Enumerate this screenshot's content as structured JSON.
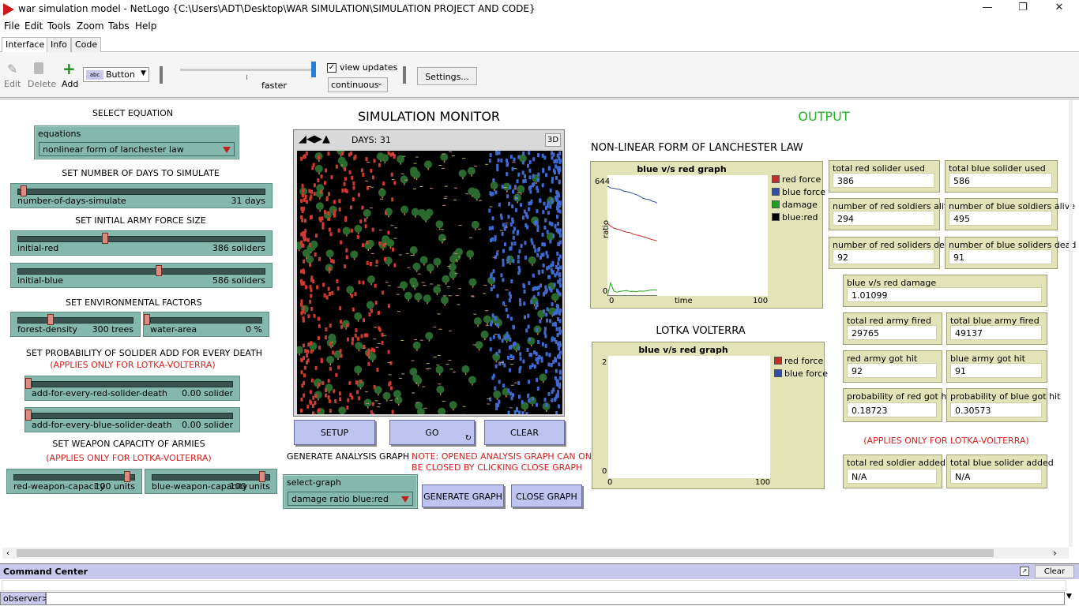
{
  "window": {
    "title": "war simulation model - NetLogo {C:\\Users\\ADT\\Desktop\\WAR SIMULATION\\SIMULATION PROJECT AND CODE}"
  },
  "menu": [
    "File",
    "Edit",
    "Tools",
    "Zoom",
    "Tabs",
    "Help"
  ],
  "tabs": [
    "Interface",
    "Info",
    "Code"
  ],
  "toolbar": {
    "edit": "Edit",
    "delete": "Delete",
    "add": "Add",
    "widget_type": "Button",
    "speed_label": "faster",
    "view_updates": "view updates",
    "update_mode": "continuous",
    "settings": "Settings..."
  },
  "left": {
    "select_equation": "SELECT EQUATION",
    "equations_label": "equations",
    "equations_value": "nonlinear form of lanchester law",
    "set_days": "SET NUMBER OF DAYS TO SIMULATE",
    "days_name": "number-of-days-simulate",
    "days_value": "31 days",
    "set_initial": "SET INITIAL ARMY FORCE SIZE",
    "red_name": "initial-red",
    "red_value": "386 soliders",
    "blue_name": "initial-blue",
    "blue_value": "586 soliders",
    "set_env": "SET ENVIRONMENTAL FACTORS",
    "forest_name": "forest-density",
    "forest_value": "300 trees",
    "water_name": "water-area",
    "water_value": "0 %",
    "set_prob": "SET PROBABILITY OF SOLIDER ADD FOR EVERY DEATH",
    "applies_lv": "(APPLIES ONLY FOR LOTKA-VOLTERRA)",
    "add_red_name": "add-for-every-red-solider-death",
    "add_red_value": "0.00 solider",
    "add_blue_name": "add-for-every-blue-solider-death",
    "add_blue_value": "0.00 solider",
    "set_weapon": "SET WEAPON CAPACITY OF ARMIES",
    "applies_lv2": "(APPLIES ONLY FOR LOTKA-VOLTERRA)",
    "rw_name": "red-weapon-capacity",
    "rw_value": "100 units",
    "bw_name": "blue-weapon-capacity",
    "bw_value": "100 units"
  },
  "center": {
    "monitor_title": "SIMULATION MONITOR",
    "days": "DAYS: 31",
    "btn3d": "3D",
    "setup": "SETUP",
    "go": "GO",
    "clear": "CLEAR",
    "gen_title": "GENERATE ANALYSIS GRAPH",
    "note1": "NOTE: OPENED ANALYSIS GRAPH CAN ONLY",
    "note2": "BE CLOSED BY CLICKING CLOSE GRAPH",
    "select_graph_label": "select-graph",
    "select_graph_value": "damage ratio blue:red",
    "generate": "GENERATE GRAPH",
    "close": "CLOSE GRAPH"
  },
  "right": {
    "output": "OUTPUT",
    "lanchester_title": "NON-LINEAR FORM OF LANCHESTER LAW",
    "lotka_title": "LOTKA VOLTERRA",
    "applies_lv3": "(APPLIES ONLY FOR LOTKA-VOLTERRA)",
    "monitors": [
      {
        "label": "total red solider used",
        "value": "386"
      },
      {
        "label": "total blue solider used",
        "value": "586"
      },
      {
        "label": "number of red soldiers alive",
        "value": "294"
      },
      {
        "label": "number of blue soldiers alive",
        "value": "495"
      },
      {
        "label": "number of red soliders dead",
        "value": "92"
      },
      {
        "label": "number of blue soliders dead",
        "value": "91"
      },
      {
        "label": "blue v/s red damage",
        "value": "1.01099"
      },
      {
        "label": "total red army fired",
        "value": "29765"
      },
      {
        "label": "total blue army fired",
        "value": "49137"
      },
      {
        "label": "red army got hit",
        "value": "92"
      },
      {
        "label": "blue army got hit",
        "value": "91"
      },
      {
        "label": "probability of red got hit",
        "value": "0.18723"
      },
      {
        "label": "probability of blue got hit",
        "value": "0.30573"
      },
      {
        "label": "total red soldier added",
        "value": "N/A"
      },
      {
        "label": "total blue solider added",
        "value": "N/A"
      }
    ]
  },
  "chart_data": [
    {
      "type": "line",
      "title": "blue v/s red graph",
      "xlabel": "time",
      "ylabel": "ratio",
      "xlim": [
        0,
        100
      ],
      "ylim": [
        0,
        644
      ],
      "x": [
        0,
        2,
        4,
        6,
        8,
        10,
        12,
        14,
        16,
        18,
        20,
        22,
        24,
        26,
        28,
        30,
        31
      ],
      "series": [
        {
          "name": "red force",
          "color": "#c0302a",
          "values": [
            386,
            372,
            362,
            356,
            352,
            345,
            340,
            338,
            330,
            325,
            322,
            316,
            312,
            305,
            300,
            296,
            294
          ]
        },
        {
          "name": "blue force",
          "color": "#2f4fa8",
          "values": [
            586,
            576,
            574,
            570,
            568,
            560,
            556,
            552,
            546,
            540,
            532,
            522,
            516,
            514,
            505,
            500,
            495
          ]
        },
        {
          "name": "damage",
          "color": "#22a022",
          "values": [
            0,
            70,
            25,
            20,
            25,
            26,
            28,
            24,
            25,
            22,
            26,
            25,
            26,
            30,
            32,
            32,
            30
          ]
        },
        {
          "name": "blue:red",
          "color": "#000000",
          "values": [
            0,
            0,
            0,
            0,
            0,
            0,
            0,
            0,
            0,
            0,
            0,
            0,
            0,
            0,
            0,
            0,
            0
          ]
        }
      ]
    },
    {
      "type": "line",
      "title": "blue v/s red graph",
      "xlabel": "",
      "ylabel": "",
      "xlim": [
        0,
        100
      ],
      "ylim": [
        0,
        2
      ],
      "series": [
        {
          "name": "red force",
          "color": "#c0302a",
          "values": []
        },
        {
          "name": "blue force",
          "color": "#2f4fa8",
          "values": []
        }
      ]
    }
  ],
  "command_center": {
    "title": "Command Center",
    "clear": "Clear",
    "prompt": "observer>"
  }
}
